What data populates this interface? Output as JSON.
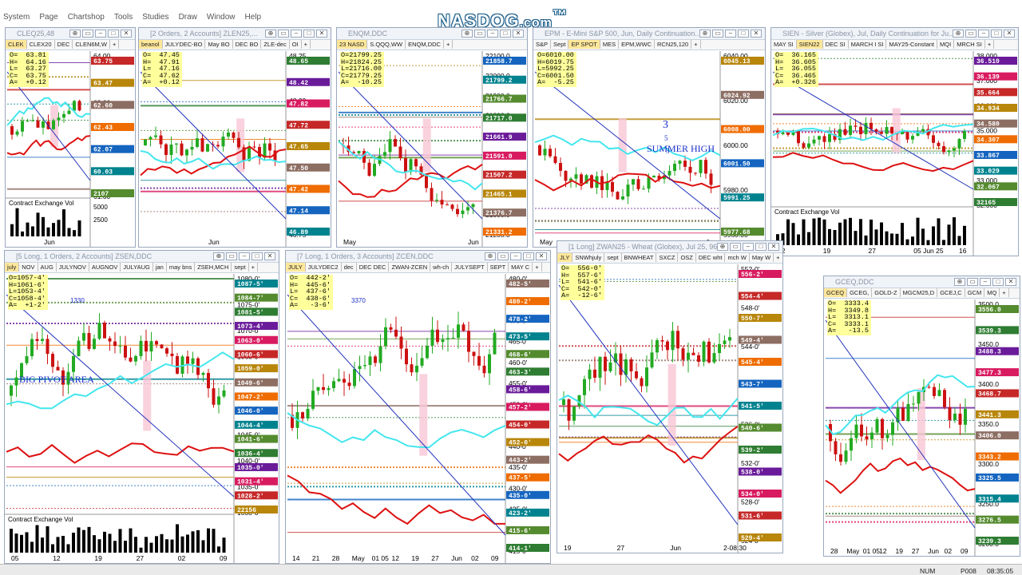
{
  "menu": [
    "System",
    "Page",
    "Chartshop",
    "Tools",
    "Studies",
    "Draw",
    "Window",
    "Help"
  ],
  "logo": {
    "text": "NASDOG",
    "suffix": ".com",
    "mark": "™"
  },
  "taskbar": {
    "num": "NUM",
    "page": "P008",
    "time": "08:35:05"
  },
  "colors": {
    "up": "#22aa22",
    "down": "#cc1111",
    "pink": "#f8c7d6",
    "cyan": "#44e6ee"
  },
  "windows": [
    {
      "id": "clr",
      "title": "CLEQ25,48",
      "tabs": [
        "CLEK",
        "CLEX20",
        "DEC",
        "CLEN6M,W"
      ],
      "active_tab": 0,
      "ohlc": [
        "O=  63.81",
        "H=  64.16",
        "L=  63.27",
        "C=  63.75",
        "A=  +0.12"
      ],
      "prices": [
        "64.00",
        "63.00",
        "62.00",
        "61.00"
      ],
      "tags": [
        "63.75",
        "63.47",
        "62.60",
        "62.43",
        "62.07",
        "60.03",
        "2107"
      ],
      "vol_label": "Contract Exchange Vol",
      "vol_ticks": [
        "5000",
        "2500"
      ],
      "dates": [
        "Jun"
      ]
    },
    {
      "id": "zlr",
      "title": "[2 Orders, 2 Accounts] ZLEN25,...",
      "tabs": [
        "beanol",
        "JULYDEC-BO",
        "May BO",
        "DEC BO",
        "ZLE-dec",
        "OI"
      ],
      "active_tab": 0,
      "ohlc": [
        "O=  47.45",
        "H=  47.91",
        "L=  47.16",
        "C=  47.62",
        "A=  +0.12"
      ],
      "prices": [
        "48.25",
        "48.00",
        "47.75",
        "47.00",
        "46.75"
      ],
      "tags": [
        "48.65",
        "48.42",
        "47.82",
        "47.72",
        "47.65",
        "47.50",
        "47.42",
        "47.14",
        "46.89"
      ],
      "dates": [
        "Jun"
      ]
    },
    {
      "id": "enq",
      "title": "ENQM,DDC",
      "tabs": [
        "23 NASD",
        "S.QQQ,WW",
        "ENQM,DDC"
      ],
      "active_tab": 0,
      "ohlc": [
        "O=21799.25",
        "H=21824.25",
        "L=21716.00",
        "C=21779.25",
        "A=  -10.25"
      ],
      "prices": [
        "22100.0",
        "22000.0",
        "21900.0",
        "21800.0",
        "21700.0",
        "21600.0",
        "21500.0",
        "21400.0",
        "21300.0",
        "21200.0"
      ],
      "tags": [
        "21858.7",
        "21799.2",
        "21766.7",
        "21717.0",
        "21661.9",
        "21591.0",
        "21507.2",
        "21465.1",
        "21376.7",
        "21331.2"
      ],
      "dates": [
        "May",
        "Jun"
      ]
    },
    {
      "id": "epm",
      "title": "EPM - E-Mini S&P 500, Jun, Daily Continuation...",
      "tabs": [
        "S&P",
        "Sept",
        "EP SPOT",
        "MES",
        "EPM,WWC",
        "RCN25,120"
      ],
      "active_tab": 2,
      "ohlc": [
        "O=6010.00",
        "H=6019.75",
        "L=5992.25",
        "C=6001.50",
        "A=  -5.25"
      ],
      "prices": [
        "6040.00",
        "6020.00",
        "6000.00",
        "5980.00",
        "5960.00"
      ],
      "tags": [
        "6045.13",
        "6024.92",
        "6008.00",
        "6001.50",
        "5991.25",
        "5977.68"
      ],
      "annotation": "SUMMER HIGH",
      "wave": [
        "3",
        "5",
        "3"
      ],
      "dates": [
        "May",
        "Jun"
      ]
    },
    {
      "id": "sie",
      "title": "SIEN - Silver (Globex), Jul, Daily Continuation for Ju...",
      "tabs": [
        "MAY SI",
        "SIEN22",
        "DEC SI",
        "MARCH I SI",
        "MAY25-Constant",
        "MQI",
        "MRCH SI"
      ],
      "active_tab": 1,
      "ohlc": [
        "O=  36.165",
        "H=  36.605",
        "L=  36.055",
        "C=  36.465",
        "A=  +0.326"
      ],
      "prices": [
        "38.000",
        "37.000",
        "36.000",
        "35.000",
        "34.000",
        "33.000",
        "32.000"
      ],
      "tags": [
        "36.510",
        "36.139",
        "35.664",
        "34.934",
        "34.580",
        "34.307",
        "33.867",
        "33.029",
        "32.067",
        "32165"
      ],
      "vol_label": "Contract Exchange Vol",
      "dates": [
        "12",
        "19",
        "27",
        "05 Jun 25",
        "16"
      ]
    },
    {
      "id": "zse",
      "title": "[5 Long, 1 Orders, 2 Accounts] ZSEN,DDC",
      "tabs": [
        "july",
        "NOV",
        "AUG",
        "JULYNOV",
        "AUGNOV",
        "JULYAUG",
        "jan",
        "may bns",
        "ZSEH,MCH",
        "sept"
      ],
      "active_tab": 0,
      "ohlc": [
        "O=1057-4'",
        "H=1061-6'",
        "L=1053-4'",
        "C=1058-4'",
        "A=  +1-2'"
      ],
      "prices": [
        "1080-0'",
        "1075-0'",
        "1070-0'",
        "1065-0'",
        "1055-0'",
        "1050-0'",
        "1045-0'",
        "1040-0'",
        "1035-0'",
        "1030-0'"
      ],
      "tags": [
        "1087-5'",
        "1084-7'",
        "1081-5'",
        "1073-4'",
        "1063-0'",
        "1060-6'",
        "1059-0'",
        "1049-6'",
        "1047-2'",
        "1046-0'",
        "1044-4'",
        "1041-6'",
        "1036-4'",
        "1035-0'",
        "1031-4'",
        "1028-2'",
        "22156"
      ],
      "annotation": "BIG PIVOT AREA",
      "swing": "1330",
      "vol_label": "Contract Exchange Vol",
      "dates": [
        "05",
        "12",
        "19",
        "27",
        "02",
        "09"
      ]
    },
    {
      "id": "zce",
      "title": "[7 Long, 1 Orders, 3 Accounts] ZCEN,DDC",
      "tabs": [
        "JULY",
        "JULYDEC2",
        "dec",
        "DEC DEC",
        "ZWAN-ZCEN",
        "wh-ch",
        "JULYSEPT",
        "SEPT",
        "MAY C"
      ],
      "active_tab": 0,
      "ohlc": [
        "O=  442-2'",
        "H=  445-6'",
        "L=  437-6'",
        "C=  438-6'",
        "A=   -3-6'"
      ],
      "prices": [
        "480-0'",
        "475-0'",
        "470-0'",
        "465-0'",
        "460-0'",
        "455-0'",
        "450-0'",
        "445-0'",
        "440-0'",
        "435-0'",
        "430-0'",
        "425-0'",
        "420-0'",
        "415-0'"
      ],
      "tags": [
        "482-5'",
        "480-2'",
        "478-2'",
        "473-5'",
        "468-6'",
        "463-3'",
        "458-6'",
        "457-2'",
        "454-0'",
        "452-0'",
        "443-2'",
        "437-5'",
        "435-0'",
        "423-2'",
        "415-6'",
        "414-1'"
      ],
      "swing": "3370",
      "dates": [
        "14",
        "21",
        "28",
        "May",
        "01 05",
        "12",
        "19",
        "27",
        "Jun",
        "02",
        "09"
      ]
    },
    {
      "id": "zwa",
      "title": "[1 Long] ZWAN25 - Wheat (Globex), Jul 25, 96 Min, P...",
      "tabs": [
        "JLY",
        "SNWhjuly",
        "sept",
        "BNWHEAT",
        "SXCZ",
        "OSZ",
        "DEC wht",
        "mch W",
        "May W"
      ],
      "active_tab": 0,
      "ohlc": [
        "O=  556-0'",
        "H=  557-6'",
        "L=  541-6'",
        "C=  542-0'",
        "A=  -12-6'"
      ],
      "prices": [
        "552-0'",
        "548-0'",
        "544-0'",
        "540-0'",
        "536-0'",
        "532-0'",
        "528-0'",
        "524-0'"
      ],
      "tags": [
        "556-2'",
        "554-4'",
        "550-7'",
        "549-4'",
        "545-4'",
        "543-7'",
        "541-5'",
        "540-6'",
        "539-2'",
        "538-0'",
        "534-0'",
        "531-6'",
        "529-4'"
      ],
      "dates": [
        "19",
        "27",
        "Jun",
        "2-08:30"
      ]
    },
    {
      "id": "gce",
      "title": "GCEQ,DDC",
      "tabs": [
        "GCEQ",
        "GCEG,",
        "GOLD-Z",
        "MGCM25,D",
        "GCEJ,C",
        "GCM",
        "MQ"
      ],
      "active_tab": 0,
      "ohlc": [
        "O=  3333.4",
        "H=  3349.8",
        "L=  3313.1",
        "C=  3333.1",
        "A=   -13.5"
      ],
      "prices": [
        "3500.0",
        "3450.0",
        "3400.0",
        "3350.0",
        "3300.0",
        "3250.0",
        "3200.0"
      ],
      "tags": [
        "3556.0",
        "3539.3",
        "3488.3",
        "3477.3",
        "3468.7",
        "3441.3",
        "3406.0",
        "3343.2",
        "3325.5",
        "3315.4",
        "3276.5",
        "3239.3"
      ],
      "dates": [
        "28",
        "May",
        "01 05",
        "12",
        "19",
        "27",
        "Jun",
        "02",
        "09"
      ]
    }
  ]
}
